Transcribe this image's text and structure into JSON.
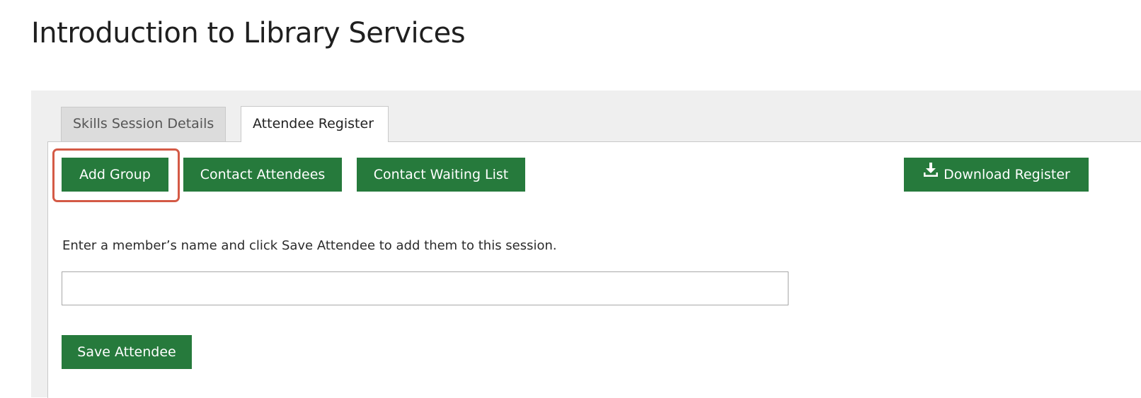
{
  "page": {
    "title": "Introduction to Library Services"
  },
  "tabs": [
    {
      "label": "Skills Session Details",
      "active": false
    },
    {
      "label": "Attendee Register",
      "active": true
    }
  ],
  "toolbar": {
    "add_group_label": "Add Group",
    "contact_attendees_label": "Contact Attendees",
    "contact_waiting_list_label": "Contact Waiting List",
    "download_register_label": "Download Register",
    "download_icon": "download-icon",
    "highlighted": "Add Group"
  },
  "form": {
    "instruction": "Enter a member’s name and click Save Attendee to add them to this session.",
    "member_input_value": "",
    "save_label": "Save Attendee"
  },
  "colors": {
    "button_green": "#267a3c",
    "highlight": "#d45a46",
    "panel_bg": "#efefef"
  }
}
